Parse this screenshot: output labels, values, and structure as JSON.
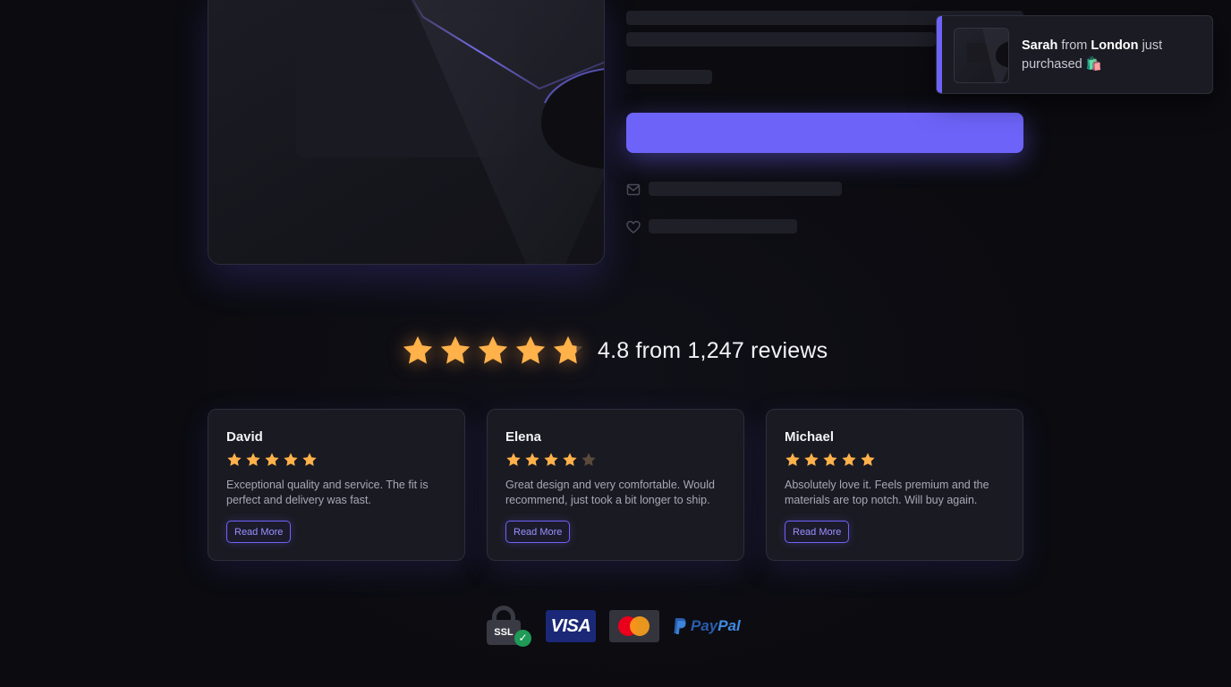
{
  "toast": {
    "name": "Sarah",
    "connector": "from",
    "city": "London",
    "action": "just purchased",
    "emoji": "🛍️"
  },
  "rating": {
    "score_text": "4.8 from 1,247 reviews",
    "value": 4.8,
    "max": 5
  },
  "reviews": [
    {
      "name": "David",
      "stars": 5,
      "text": "Exceptional quality and service. The fit is perfect and delivery was fast.",
      "button": "Read More"
    },
    {
      "name": "Elena",
      "stars": 4,
      "text": "Great design and very comfortable. Would recommend, just took a bit longer to ship.",
      "button": "Read More"
    },
    {
      "name": "Michael",
      "stars": 5,
      "text": "Absolutely love it. Feels premium and the materials are top notch. Will buy again.",
      "button": "Read More"
    }
  ],
  "payment": {
    "ssl": "SSL",
    "visa": "VISA",
    "paypal_a": "Pay",
    "paypal_b": "Pal"
  },
  "icons": {
    "mail": "mail-icon",
    "heart": "heart-icon",
    "star": "star-icon",
    "check": "check-icon",
    "lock": "lock-icon"
  },
  "colors": {
    "accent": "#6e63f8",
    "star": "#ffb14a",
    "star_empty": "#5a4a3c",
    "background": "#0b0b10",
    "card": "#1a1a22"
  }
}
